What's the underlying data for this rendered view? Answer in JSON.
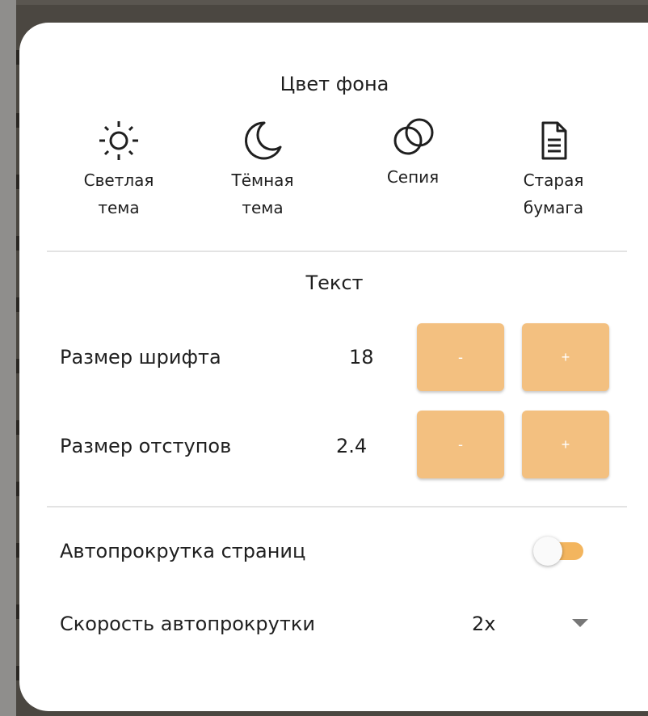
{
  "background_section": {
    "title": "Цвет фона",
    "themes": [
      {
        "icon": "sun-icon",
        "label": "Светлая\nтема"
      },
      {
        "icon": "moon-icon",
        "label": "Тёмная\nтема"
      },
      {
        "icon": "overlapping-circles-icon",
        "label": "Сепия"
      },
      {
        "icon": "document-icon",
        "label": "Старая\nбумага"
      }
    ]
  },
  "text_section": {
    "title": "Текст",
    "font_size": {
      "label": "Размер шрифта",
      "value": "18",
      "minus": "-",
      "plus": "+"
    },
    "spacing": {
      "label": "Размер отступов",
      "value": "2.4",
      "minus": "-",
      "plus": "+"
    }
  },
  "autoscroll": {
    "label": "Автопрокрутка страниц",
    "enabled": false
  },
  "autoscroll_speed": {
    "label": "Скорость автопрокрутки",
    "value": "2x"
  },
  "colors": {
    "accent_button": "#f3c080",
    "toggle_track": "#f3b55e",
    "backdrop": "#4b4741"
  }
}
